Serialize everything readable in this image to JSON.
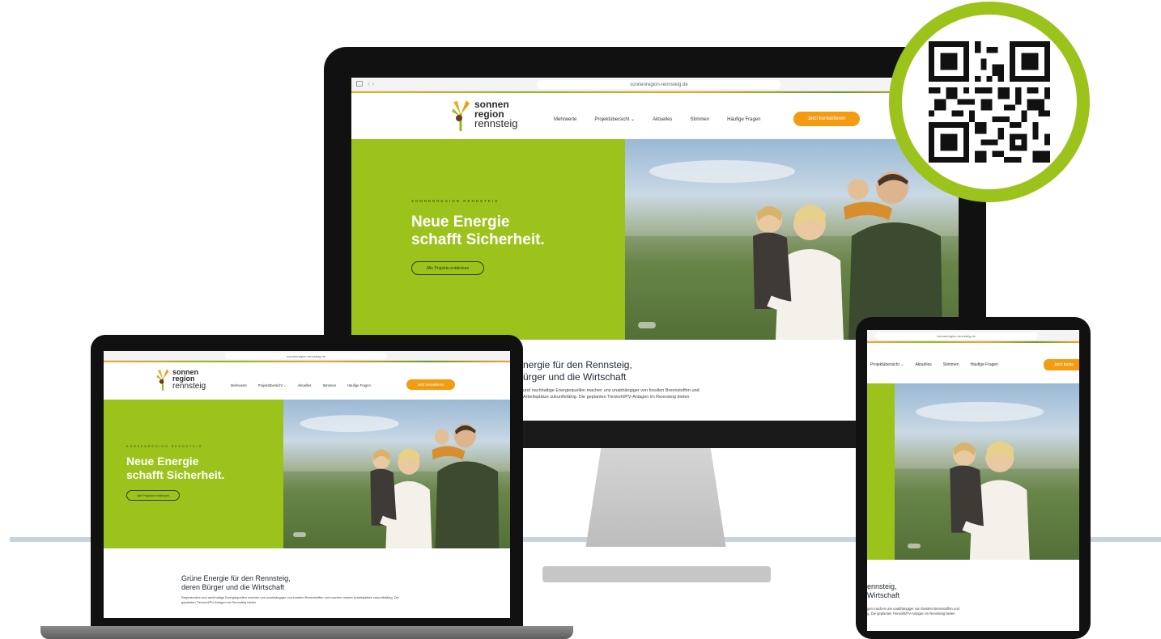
{
  "site": {
    "url": "sonnenregion-rennsteig.de",
    "logo": {
      "line1": "sonnen",
      "line2": "region",
      "line3": "rennsteig"
    },
    "nav": [
      "Mehrwerte",
      "Projektübersicht",
      "Aktuelles",
      "Stimmen",
      "Häufige Fragen"
    ],
    "cta": "Jetzt kontaktieren",
    "eyebrow": "SONNENREGION RENNSTEIG",
    "headline1": "Neue Energie",
    "headline2": "schafft Sicherheit.",
    "hero_button": "Alle Projekte entdecken",
    "section_title1": "Grüne Energie für den Rennsteig,",
    "section_title2": "deren Bürger und die Wirtschaft",
    "body": "Regenerative und nachhaltige Energiequellen machen uns unabhängiger von fossilen Brennstoffen und machen unsere Arbeitsplätze zukunftsfähig. Die geplanten Tierwohl/PV-Anlagen im Rennsteig bieten"
  },
  "monitor_section": {
    "title1": "nergie für den Rennsteig,",
    "title2": "ürger und die Wirtschaft",
    "body1": "und nachhaltige Energiequellen machen uns unabhängiger von fossilen Brennstoffen und",
    "body2": "Arbeitsplätze zukunftsfähig. Die geplanten Tierwohl/PV-Anlagen im Rennsteig bieten"
  },
  "tablet": {
    "nav": [
      "Projektübersicht",
      "Aktuelles",
      "Stimmen",
      "Häufige Fragen"
    ],
    "cta": "Jetzt konta",
    "title1": "ennsteig,",
    "title2": "Wirtschaft",
    "body1": "gen machen uns unabhängiger von fossilen Brennstoffen und",
    "body2": "g. Die geplanten Tierwohl/PV-Anlagen im Rennsteig bieten"
  },
  "colors": {
    "green": "#9cc31c",
    "orange": "#f39c12",
    "ring": "#9cc31c"
  },
  "icons": [
    "qr-code-icon",
    "sun-logo-icon",
    "chevron-down-icon"
  ]
}
